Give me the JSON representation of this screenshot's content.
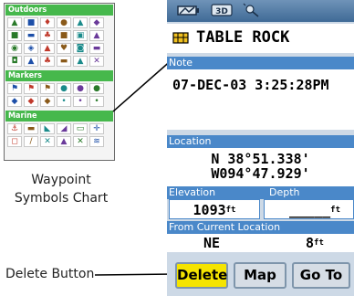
{
  "captions": {
    "symbols_chart": "Waypoint Symbols Chart",
    "delete_button": "Delete Button"
  },
  "symbols_chart": {
    "categories": [
      {
        "name": "Outdoors",
        "symbols": [
          "▲",
          "■",
          "♦",
          "●",
          "▲",
          "◆",
          "■",
          "▬",
          "♣",
          "■",
          "▣",
          "▲",
          "◉",
          "◈",
          "▲",
          "♥",
          "◙",
          "▬",
          "◘",
          "▲",
          "♣",
          "▬",
          "▲",
          "✕"
        ]
      },
      {
        "name": "Markers",
        "symbols": [
          "⚑",
          "⚑",
          "⚑",
          "●",
          "●",
          "●",
          "◆",
          "◆",
          "◆",
          "•",
          "•",
          "•"
        ]
      },
      {
        "name": "Marine",
        "symbols": [
          "⚓",
          "▬",
          "◣",
          "◢",
          "▭",
          "✛",
          "◻",
          "/",
          "✕",
          "▲",
          "✕",
          "≋"
        ]
      }
    ]
  },
  "device": {
    "status_icons": [
      "battery-icon",
      "3d-icon",
      "satellite-icon"
    ],
    "waypoint_name": "TABLE ROCK",
    "note_label": "Note",
    "note_text": "07-DEC-03 3:25:28PM",
    "location_label": "Location",
    "location_lat": "N  38°51.338'",
    "location_lon": "W094°47.929'",
    "elevation_label": "Elevation",
    "depth_label": "Depth",
    "elevation_value": "1093",
    "elevation_unit": "ft",
    "depth_value": "_____",
    "depth_unit": "ft",
    "from_current_label": "From Current Location",
    "bearing": "NE",
    "distance": "8",
    "distance_unit": "ft",
    "buttons": {
      "delete": "Delete",
      "map": "Map",
      "goto": "Go To"
    },
    "colors": {
      "label_bar": "#4a88c9",
      "active_button": "#f5e400",
      "category_bar": "#46b84c"
    }
  }
}
